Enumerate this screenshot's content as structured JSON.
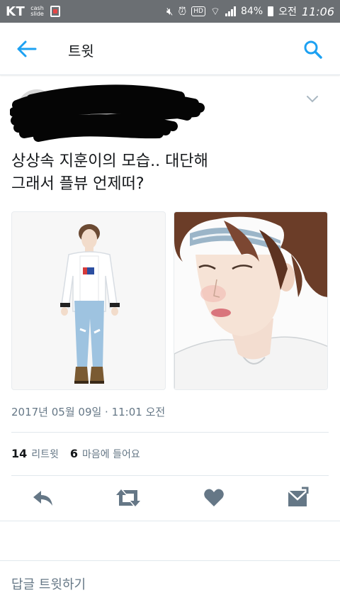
{
  "status_bar": {
    "carrier": "KT",
    "cashslide": "cash\nslide",
    "hd": "HD",
    "battery": "84%",
    "ampm": "오전",
    "time": "11:06"
  },
  "header": {
    "title": "트윗",
    "back_icon": "arrow-left-icon",
    "search_icon": "search-icon"
  },
  "tweet": {
    "text_line1": "상상속 지훈이의 모습.. 대단해",
    "text_line2": "그래서 플뷰 언제떠?",
    "timestamp": "2017년 05월 09일 · 11:01 오전",
    "retweets_count": "14",
    "retweets_label": "리트윗",
    "likes_count": "6",
    "likes_label": "마음에 들어요"
  },
  "actions": [
    "reply-icon",
    "retweet-icon",
    "heart-icon",
    "message-icon"
  ],
  "reply_prompt": "답글 트윗하기",
  "colors": {
    "accent": "#1da1f2",
    "action_gray": "#657786",
    "status_bar": "#6b6f73"
  }
}
